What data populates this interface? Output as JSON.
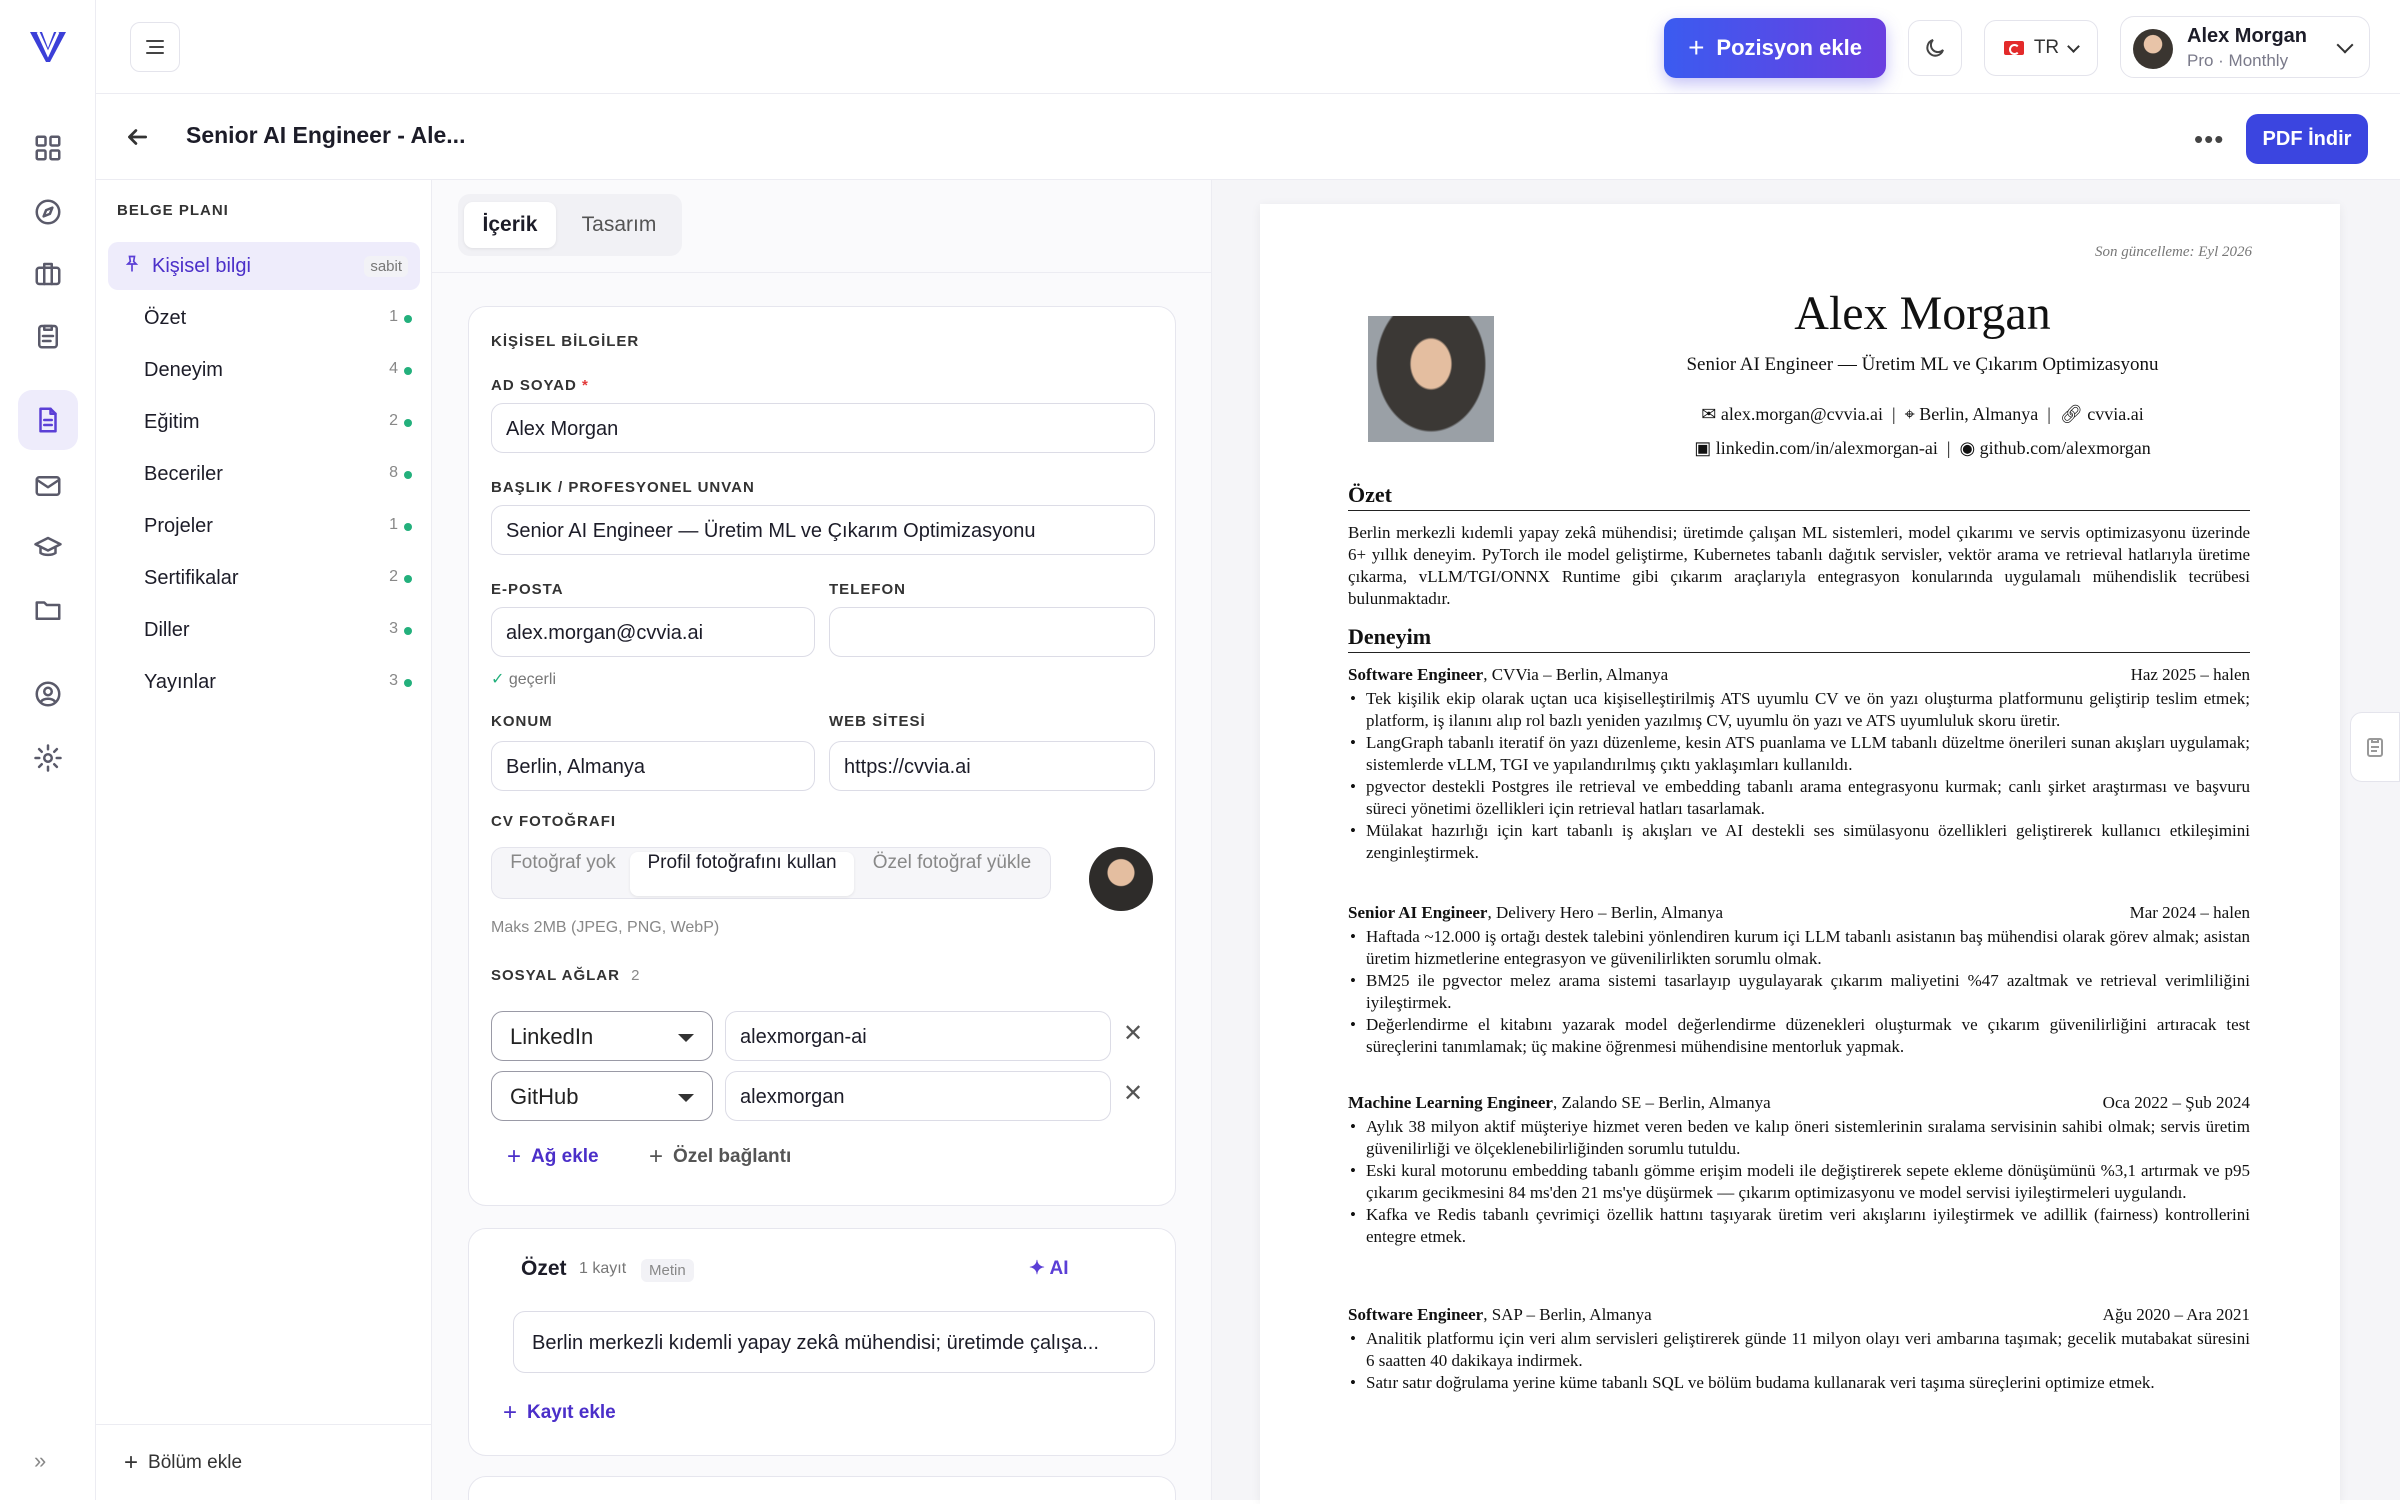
{
  "topbar": {
    "add_position_label": "Pozisyon ekle",
    "lang": "TR",
    "user_name": "Alex Morgan",
    "user_plan": "Pro · Monthly"
  },
  "subheader": {
    "title": "Senior AI Engineer - Ale...",
    "pdf_label": "PDF İndir"
  },
  "plan": {
    "heading": "BELGE PLANI",
    "items": [
      {
        "label": "Kişisel bilgi",
        "badge": "sabit"
      },
      {
        "label": "Özet",
        "count": "1"
      },
      {
        "label": "Deneyim",
        "count": "4"
      },
      {
        "label": "Eğitim",
        "count": "2"
      },
      {
        "label": "Beceriler",
        "count": "8"
      },
      {
        "label": "Projeler",
        "count": "1"
      },
      {
        "label": "Sertifikalar",
        "count": "2"
      },
      {
        "label": "Diller",
        "count": "3"
      },
      {
        "label": "Yayınlar",
        "count": "3"
      }
    ],
    "add_section": "Bölüm ekle"
  },
  "editor": {
    "tabs": [
      "İçerik",
      "Tasarım"
    ],
    "personal": {
      "heading": "KİŞİSEL BİLGİLER",
      "name_label": "AD SOYAD",
      "name_value": "Alex Morgan",
      "title_label": "BAŞLIK / PROFESYONEL UNVAN",
      "title_value": "Senior AI Engineer — Üretim ML ve Çıkarım Optimizasyonu",
      "email_label": "E-POSTA",
      "email_value": "alex.morgan@cvvia.ai",
      "email_valid": "geçerli",
      "phone_label": "TELEFON",
      "phone_value": "",
      "location_label": "KONUM",
      "location_value": "Berlin, Almanya",
      "website_label": "WEB SİTESİ",
      "website_value": "https://cvvia.ai",
      "photo_label": "CV FOTOĞRAFI",
      "photo_options": [
        "Fotoğraf yok",
        "Profil fotoğrafını kullan",
        "Özel fotoğraf yükle"
      ],
      "photo_hint": "Maks 2MB (JPEG, PNG, WebP)",
      "social_label": "SOSYAL AĞLAR",
      "social_count": "2",
      "socials": [
        {
          "network": "LinkedIn",
          "handle": "alexmorgan-ai"
        },
        {
          "network": "GitHub",
          "handle": "alexmorgan"
        }
      ],
      "add_network": "Ağ ekle",
      "custom_link": "Özel bağlantı"
    },
    "summary": {
      "title": "Özet",
      "count": "1 kayıt",
      "tag": "Metin",
      "ai": "AI",
      "text": "Berlin merkezli kıdemli yapay zekâ mühendisi; üretimde çalışa...",
      "add_record": "Kayıt ekle"
    }
  },
  "cv": {
    "updated": "Son güncelleme: Eyl 2026",
    "name": "Alex Morgan",
    "role": "Senior AI Engineer — Üretim ML ve Çıkarım Optimizasyonu",
    "email": "alex.morgan@cvvia.ai",
    "location": "Berlin, Almanya",
    "website": "cvvia.ai",
    "linkedin": "linkedin.com/in/alexmorgan-ai",
    "github": "github.com/alexmorgan",
    "summary_heading": "Özet",
    "summary": "Berlin merkezli kıdemli yapay zekâ mühendisi; üretimde çalışan ML sistemleri, model çıkarımı ve servis optimizasyonu üzerinde 6+ yıllık deneyim. PyTorch ile model geliştirme, Kubernetes tabanlı dağıtık servisler, vektör arama ve retrieval hatlarıyla üretime çıkarma, vLLM/TGI/ONNX Runtime gibi çıkarım araçlarıyla entegrasyon konularında uygulamalı mühendislik tecrübesi bulunmaktadır.",
    "experience_heading": "Deneyim",
    "jobs": [
      {
        "title": "Software Engineer",
        "company": ", CVVia – Berlin, Almanya",
        "dates": "Haz 2025 – halen",
        "bullets": [
          "Tek kişilik ekip olarak uçtan uca kişiselleştirilmiş ATS uyumlu CV ve ön yazı oluşturma platformunu geliştirip teslim etmek; platform, iş ilanını alıp rol bazlı yeniden yazılmış CV, uyumlu ön yazı ve ATS uyumluluk skoru üretir.",
          "LangGraph tabanlı iteratif ön yazı düzenleme, kesin ATS puanlama ve LLM tabanlı düzeltme önerileri sunan akışları uygulamak; sistemlerde vLLM, TGI ve yapılandırılmış çıktı yaklaşımları kullanıldı.",
          "pgvector destekli Postgres ile retrieval ve embedding tabanlı arama entegrasyonu kurmak; canlı şirket araştırması ve başvuru süreci yönetimi özellikleri için retrieval hatları tasarlamak.",
          "Mülakat hazırlığı için kart tabanlı iş akışları ve AI destekli ses simülasyonu özellikleri geliştirerek kullanıcı etkileşimini zenginleştirmek."
        ]
      },
      {
        "title": "Senior AI Engineer",
        "company": ", Delivery Hero – Berlin, Almanya",
        "dates": "Mar 2024 – halen",
        "bullets": [
          "Haftada ~12.000 iş ortağı destek talebini yönlendiren kurum içi LLM tabanlı asistanın baş mühendisi olarak görev almak; asistan üretim hizmetlerine entegrasyon ve güvenilirlikten sorumlu olmak.",
          "BM25 ile pgvector melez arama sistemi tasarlayıp uygulayarak çıkarım maliyetini %47 azaltmak ve retrieval verimliliğini iyileştirmek.",
          "Değerlendirme el kitabını yazarak model değerlendirme düzenekleri oluşturmak ve çıkarım güvenilirliğini artıracak test süreçlerini tanımlamak; üç makine öğrenmesi mühendisine mentorluk yapmak."
        ]
      },
      {
        "title": "Machine Learning Engineer",
        "company": ", Zalando SE – Berlin, Almanya",
        "dates": "Oca 2022 – Şub 2024",
        "bullets": [
          "Aylık 38 milyon aktif müşteriye hizmet veren beden ve kalıp öneri sistemlerinin sıralama servisinin sahibi olmak; servis üretim güvenilirliği ve ölçeklenebilirliğinden sorumlu tutuldu.",
          "Eski kural motorunu embedding tabanlı gömme erişim modeli ile değiştirerek sepete ekleme dönüşümünü %3,1 artırmak ve p95 çıkarım gecikmesini 84 ms'den 21 ms'ye düşürmek — çıkarım optimizasyonu ve model servisi iyileştirmeleri uygulandı.",
          "Kafka ve Redis tabanlı çevrimiçi özellik hattını taşıyarak üretim veri akışlarını iyileştirmek ve adillik (fairness) kontrollerini entegre etmek."
        ]
      },
      {
        "title": "Software Engineer",
        "company": ", SAP – Berlin, Almanya",
        "dates": "Ağu 2020 – Ara 2021",
        "bullets": [
          "Analitik platformu için veri alım servisleri geliştirerek günde 11 milyon olayı veri ambarına taşımak; gecelik mutabakat süresini 6 saatten 40 dakikaya indirmek.",
          "Satır satır doğrulama yerine küme tabanlı SQL ve bölüm budama kullanarak veri taşıma süreçlerini optimize etmek."
        ]
      }
    ]
  }
}
